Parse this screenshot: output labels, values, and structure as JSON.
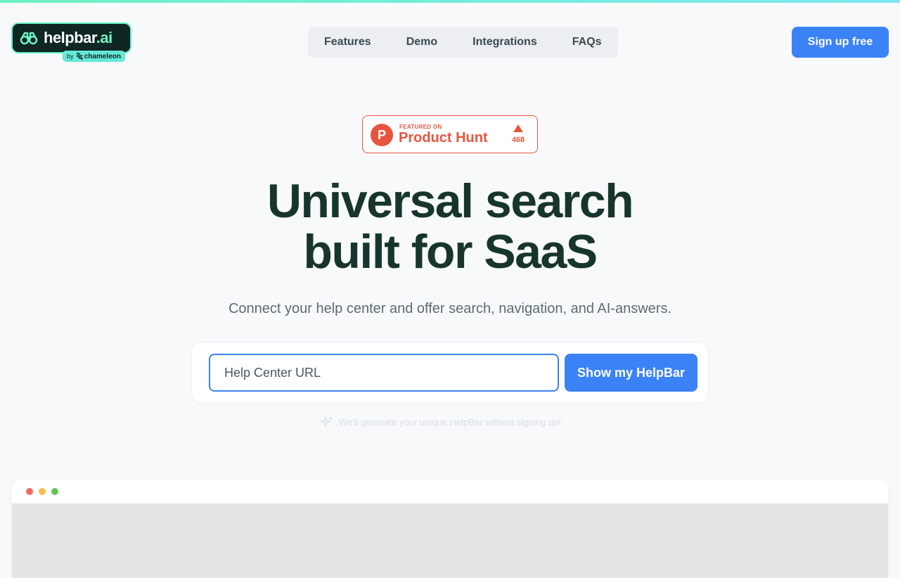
{
  "brand": {
    "name_main": "helpbar",
    "name_suffix": ".ai",
    "by_label": "by",
    "parent": "chameleon",
    "accent": "#6ef3c4"
  },
  "nav": {
    "items": [
      {
        "label": "Features"
      },
      {
        "label": "Demo"
      },
      {
        "label": "Integrations"
      },
      {
        "label": "FAQs"
      }
    ],
    "signup_label": "Sign up free"
  },
  "product_hunt": {
    "featured_label": "FEATURED ON",
    "name": "Product Hunt",
    "votes": "468",
    "logo_letter": "P",
    "color": "#e8553f"
  },
  "hero": {
    "title_line1": "Universal search",
    "title_line2": "built for SaaS",
    "subtitle": "Connect your help center and offer search, navigation, and AI-answers."
  },
  "form": {
    "input_placeholder": "Help Center URL",
    "input_value": "",
    "submit_label": "Show my HelpBar",
    "note": "We'll generate your unique HelpBar without signing up!"
  },
  "colors": {
    "primary": "#3b82f6",
    "heading": "#17352d",
    "background": "#f7f9fb"
  }
}
